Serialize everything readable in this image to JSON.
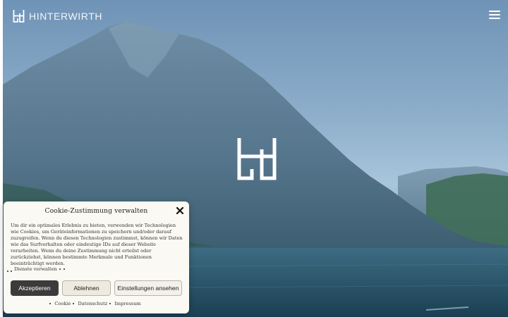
{
  "brand": {
    "name": "HINTERWIRTH"
  },
  "header": {
    "menu_icon": "hamburger-menu-icon"
  },
  "hero": {
    "center_logo_icon": "hinterwirth-logo-icon"
  },
  "cookie_dialog": {
    "title": "Cookie-Zustimmung verwalten",
    "close_icon": "close-icon",
    "body": "Um dir ein optimales Erlebnis zu bieten, verwenden wir Technologien wie Cookies, um Geräteinformationen zu speichern und/oder darauf zuzugreifen. Wenn du diesen Technologien zustimmst, können wir Daten wie das Surfverhalten oder eindeutige IDs auf dieser Website verarbeiten. Wenn du deine Zustimmung nicht erteilst oder zurückziehst, können bestimmte Merkmale und Funktionen beeinträchtigt werden.",
    "manage_services": "Dienste verwalten",
    "buttons": {
      "accept": "Akzeptieren",
      "deny": "Ablehnen",
      "settings": "Einstellungen ansehen"
    },
    "links": [
      "Cookie",
      "Datenschutz",
      "Impressum"
    ]
  }
}
